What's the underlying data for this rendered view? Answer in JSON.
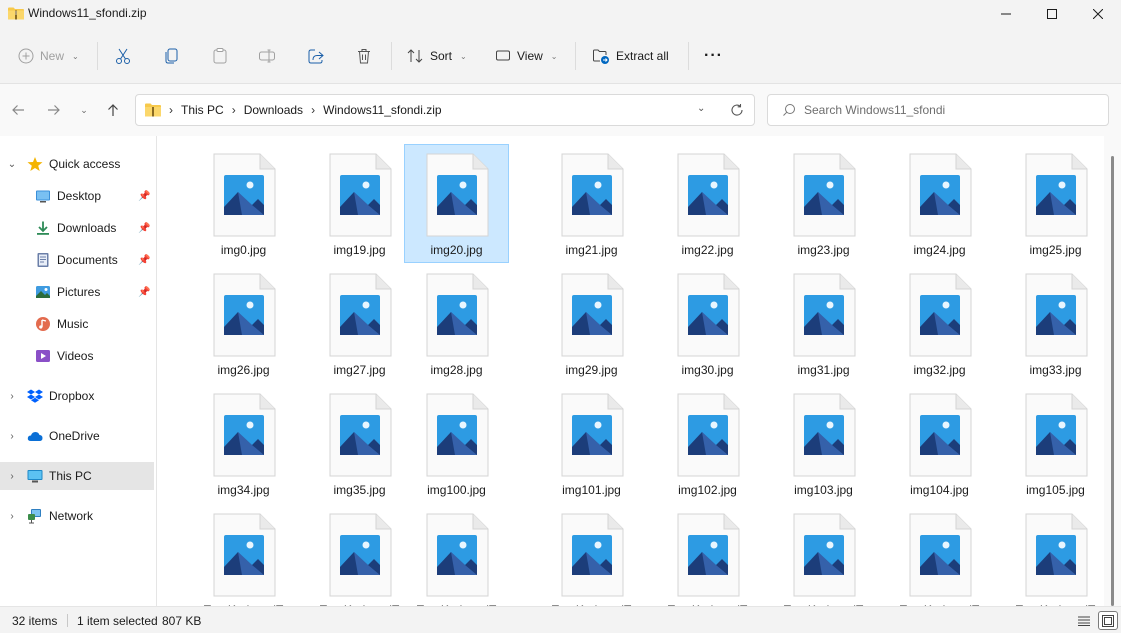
{
  "window": {
    "title": "Windows11_sfondi.zip"
  },
  "toolbar": {
    "new_label": "New",
    "sort_label": "Sort",
    "view_label": "View",
    "extract_label": "Extract all",
    "more_label": "···"
  },
  "address": {
    "crumbs": [
      "This PC",
      "Downloads",
      "Windows11_sfondi.zip"
    ]
  },
  "search": {
    "placeholder": "Search Windows11_sfondi"
  },
  "sidebar": {
    "items": [
      {
        "label": "Quick access",
        "icon": "star-icon"
      },
      {
        "label": "Desktop",
        "icon": "desktop-icon"
      },
      {
        "label": "Downloads",
        "icon": "download-icon"
      },
      {
        "label": "Documents",
        "icon": "documents-icon"
      },
      {
        "label": "Pictures",
        "icon": "pictures-icon"
      },
      {
        "label": "Music",
        "icon": "music-icon"
      },
      {
        "label": "Videos",
        "icon": "videos-icon"
      },
      {
        "label": "Dropbox",
        "icon": "dropbox-icon"
      },
      {
        "label": "OneDrive",
        "icon": "onedrive-icon"
      },
      {
        "label": "This PC",
        "icon": "this-pc-icon"
      },
      {
        "label": "Network",
        "icon": "network-icon"
      }
    ]
  },
  "files": [
    "img0.jpg",
    "img19.jpg",
    "img20.jpg",
    "img21.jpg",
    "img22.jpg",
    "img23.jpg",
    "img24.jpg",
    "img25.jpg",
    "img26.jpg",
    "img27.jpg",
    "img28.jpg",
    "img29.jpg",
    "img30.jpg",
    "img31.jpg",
    "img32.jpg",
    "img33.jpg",
    "img34.jpg",
    "img35.jpg",
    "img100.jpg",
    "img101.jpg",
    "img102.jpg",
    "img103.jpg",
    "img104.jpg",
    "img105.jpg",
    "TrueKarbonalT",
    "TrueKarbonalT",
    "TrueKarbonalT",
    "TrueKarbonalT",
    "TrueKarbonalT",
    "TrueKarbonalT",
    "TrueKarbonalT",
    "TrueKarbonalT"
  ],
  "selected_file": "img20.jpg",
  "status": {
    "count": "32 items",
    "selection": "1 item selected",
    "size": "807 KB"
  },
  "colors": {
    "accent": "#0067c0",
    "selection_bg": "#cce8ff",
    "selection_border": "#99d1ff",
    "folder": "#f7c94b"
  }
}
